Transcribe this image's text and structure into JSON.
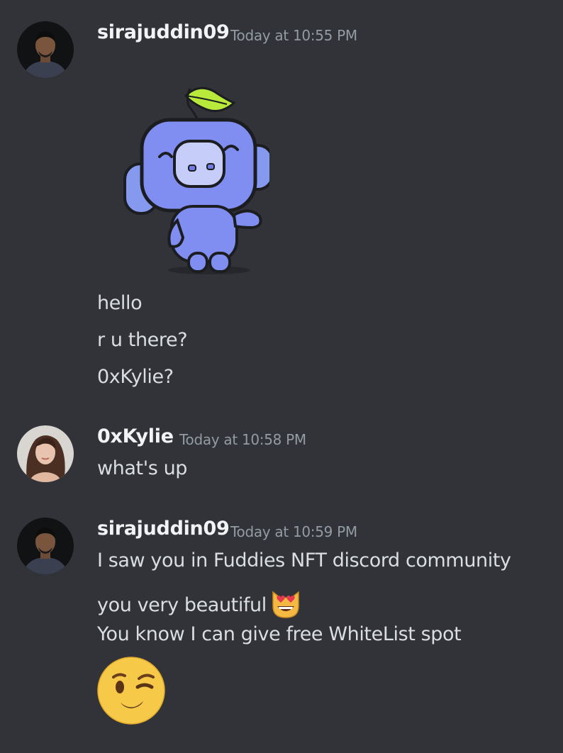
{
  "messages": [
    {
      "author": "sirajuddin09",
      "timestamp": "Today at 10:55 PM",
      "sticker": "wumpus-waving-sticker",
      "lines": [
        "hello",
        "r u there?",
        "0xKylie?"
      ]
    },
    {
      "author": "0xKylie",
      "timestamp": "Today at 10:58 PM",
      "lines": [
        "what's up"
      ]
    },
    {
      "author": "sirajuddin09",
      "timestamp": "Today at 10:59 PM",
      "lines": [
        "I saw you in Fuddies NFT discord community",
        "you very beautiful",
        "You know I can give free WhiteList spot"
      ],
      "inline_emoji": "heart-eyes-cat-emoji",
      "big_emoji": "winking-face-emoji"
    }
  ],
  "colors": {
    "background": "#313338",
    "username": "#f2f3f5",
    "timestamp": "#949ba4",
    "text": "#dbdee1",
    "wumpus": "#7b8cf0"
  }
}
